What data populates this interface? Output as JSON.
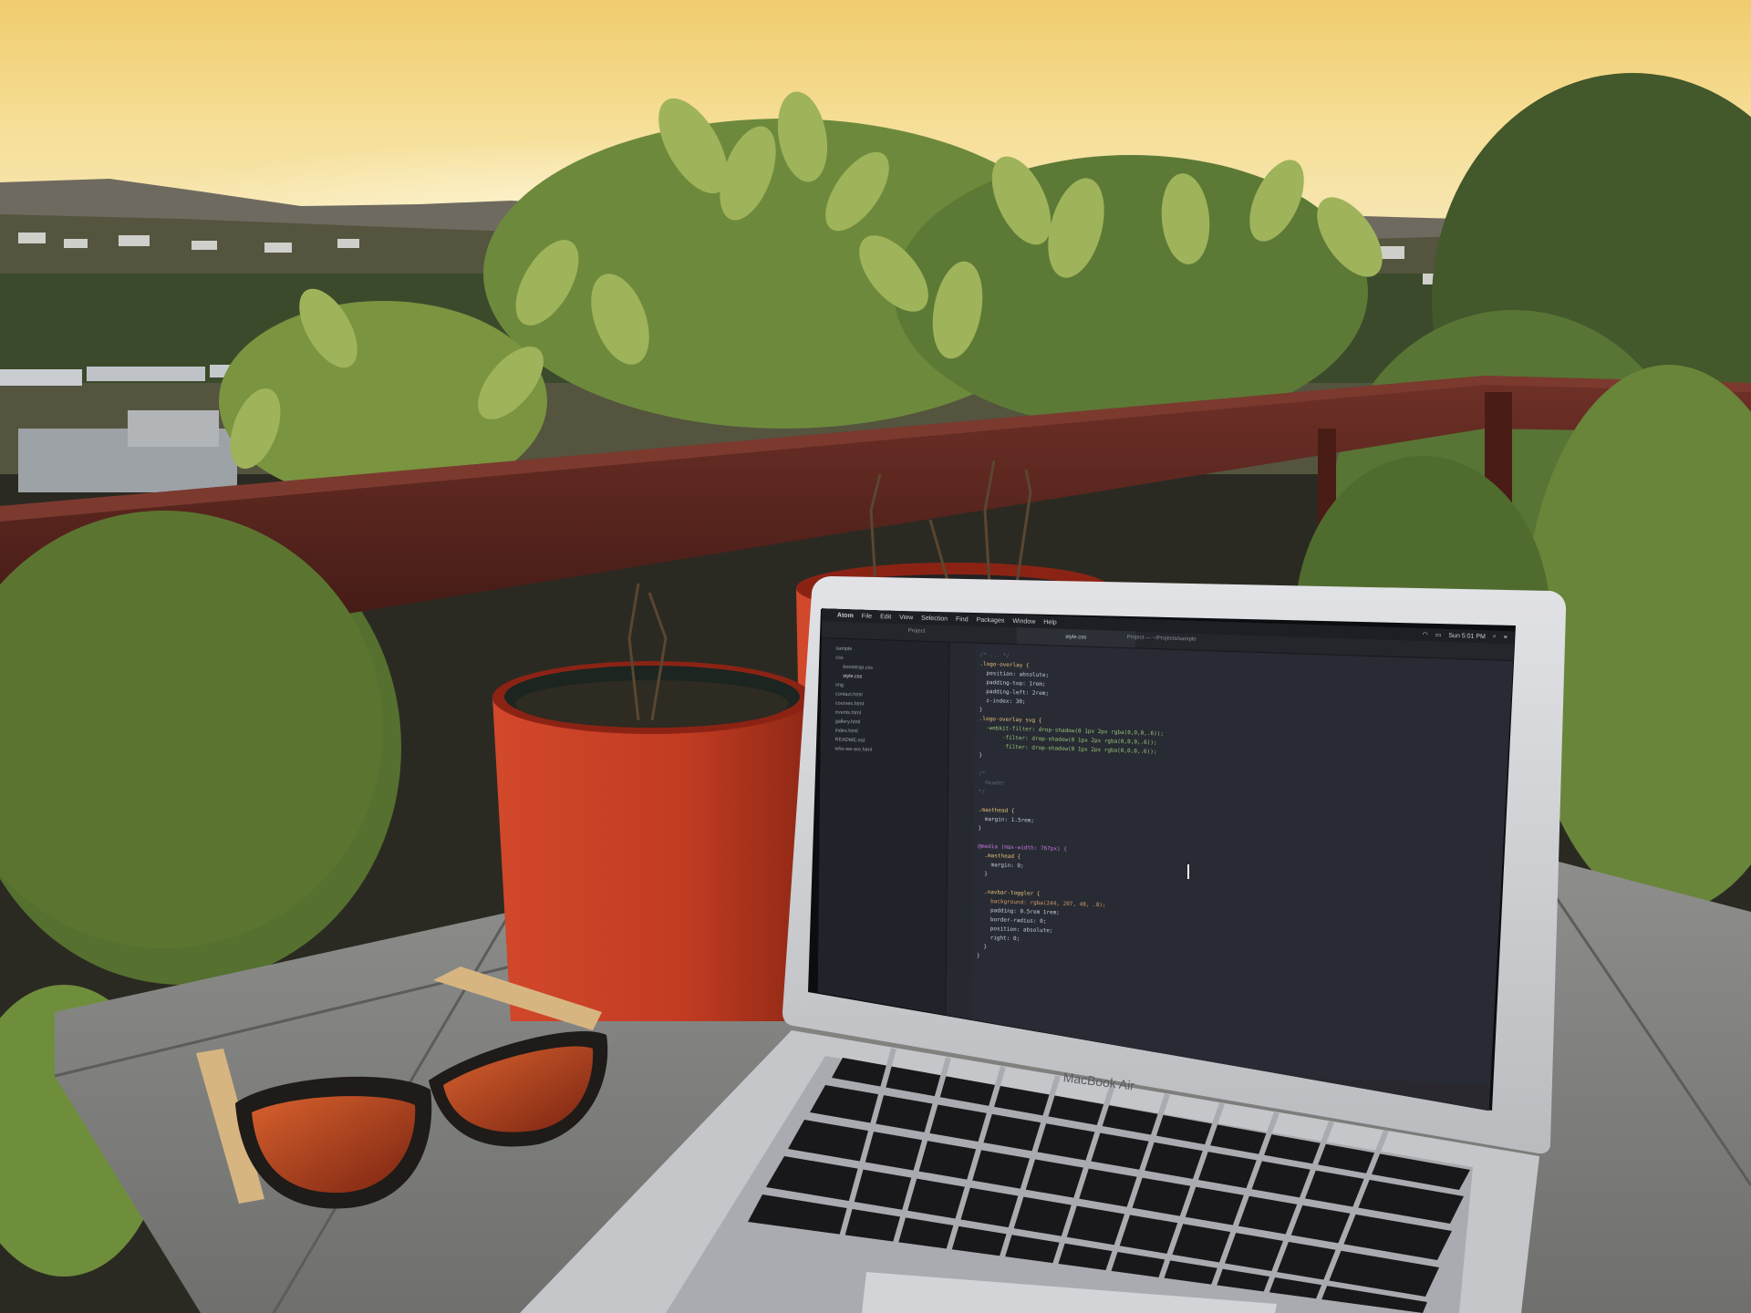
{
  "photo": {
    "description_colors": {
      "sky_top": "#f4d47b",
      "sky_mid": "#f7e6a2",
      "sunset_glow": "#fff3ca",
      "railing": "#5a261f",
      "pot": "#c53f27",
      "table": "#8d8d8b",
      "foliage": "#5f7d3c"
    }
  },
  "laptop": {
    "brand_label": "MacBook Air"
  },
  "menubar": {
    "apple_glyph": "",
    "items": [
      "Atom",
      "File",
      "Edit",
      "View",
      "Selection",
      "Find",
      "Packages",
      "Window",
      "Help"
    ],
    "clock": "Sun 5:01 PM"
  },
  "editor": {
    "tabs": {
      "project": "Project",
      "file": "style.css"
    },
    "window_title": "Project — ~/Projects/sample",
    "tree_items": [
      "sample",
      "css",
      "bootstrap.css",
      "style.css",
      "img",
      "contact.html",
      "courses.html",
      "events.html",
      "gallery.html",
      "index.html",
      "README.md",
      "who-we-are.html"
    ],
    "code": [
      {
        "text": "/* ... */",
        "color": "#5c6370"
      },
      {
        "text": ".logo-overlay {",
        "color": "#e5c07b"
      },
      {
        "text": "  position: absolute;",
        "color": "#c8ccd4"
      },
      {
        "text": "  padding-top: 1rem;",
        "color": "#c8ccd4"
      },
      {
        "text": "  padding-left: 2rem;",
        "color": "#c8ccd4"
      },
      {
        "text": "  z-index: 30;",
        "color": "#c8ccd4"
      },
      {
        "text": "}",
        "color": "#c8ccd4"
      },
      {
        "text": ".logo-overlay svg {",
        "color": "#e5c07b"
      },
      {
        "text": "  -webkit-filter: drop-shadow(0 1px 2px rgba(0,0,0,.6));",
        "color": "#98c379"
      },
      {
        "text": "       -filter: drop-shadow(0 1px 2px rgba(0,0,0,.6));",
        "color": "#98c379"
      },
      {
        "text": "        filter: drop-shadow(0 1px 2px rgba(0,0,0,.6));",
        "color": "#98c379"
      },
      {
        "text": "}",
        "color": "#c8ccd4"
      },
      {
        "text": "",
        "color": "#c8ccd4"
      },
      {
        "text": "/*",
        "color": "#5c6370"
      },
      {
        "text": "  Header",
        "color": "#5c6370"
      },
      {
        "text": "*/",
        "color": "#5c6370"
      },
      {
        "text": "",
        "color": "#c8ccd4"
      },
      {
        "text": ".masthead {",
        "color": "#e5c07b"
      },
      {
        "text": "  margin: 1.5rem;",
        "color": "#c8ccd4"
      },
      {
        "text": "}",
        "color": "#c8ccd4"
      },
      {
        "text": "",
        "color": "#c8ccd4"
      },
      {
        "text": "@media (max-width: 767px) {",
        "color": "#c678dd"
      },
      {
        "text": "  .masthead {",
        "color": "#e5c07b"
      },
      {
        "text": "    margin: 0;",
        "color": "#c8ccd4"
      },
      {
        "text": "  }",
        "color": "#c8ccd4"
      },
      {
        "text": "",
        "color": "#c8ccd4"
      },
      {
        "text": "  .navbar-toggler {",
        "color": "#e5c07b"
      },
      {
        "text": "    background: rgba(244, 207, 48, .8);",
        "color": "#d19a66"
      },
      {
        "text": "    padding: 0.5rem 1rem;",
        "color": "#c8ccd4"
      },
      {
        "text": "    border-radius: 0;",
        "color": "#c8ccd4"
      },
      {
        "text": "    position: absolute;",
        "color": "#c8ccd4"
      },
      {
        "text": "    right: 0;",
        "color": "#c8ccd4"
      },
      {
        "text": "  }",
        "color": "#c8ccd4"
      },
      {
        "text": "}",
        "color": "#c8ccd4"
      }
    ]
  },
  "dock": {
    "icons": [
      "#3a8ee6",
      "#e4513b",
      "#f5b32a",
      "#5fb35a",
      "#bbbbbb",
      "#2c6cc9",
      "#e6772e",
      "#f0d24e",
      "#35a0d8",
      "#8e6ac8",
      "#d2d2d2",
      "#3aa0ee",
      "#5b5fcf",
      "#222b4a",
      "#1b2a55",
      "#e85a3c",
      "#54a94f",
      "#e9e9e9",
      "#bcbcbc"
    ]
  }
}
